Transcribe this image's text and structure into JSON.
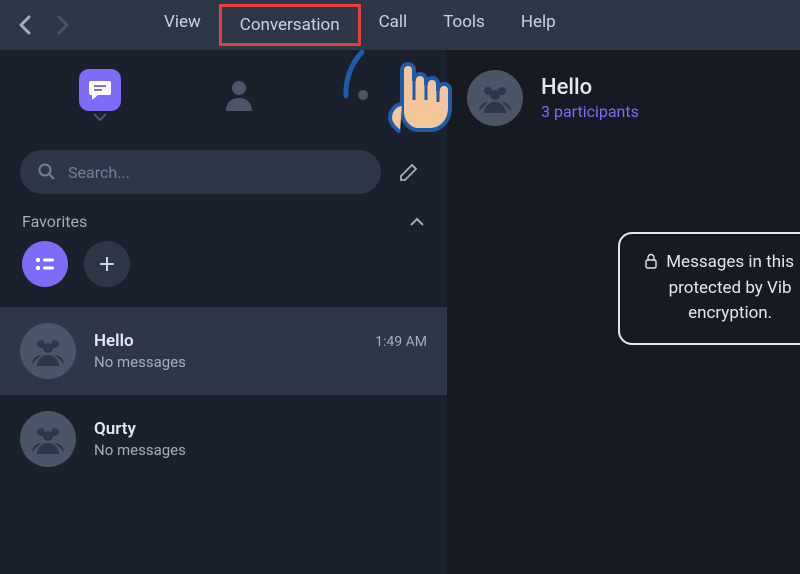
{
  "menu": {
    "items": [
      "View",
      "Conversation",
      "Call",
      "Tools",
      "Help"
    ],
    "highlighted_index": 1
  },
  "sidebar": {
    "search": {
      "placeholder": "Search..."
    },
    "favorites": {
      "label": "Favorites"
    },
    "chats": [
      {
        "name": "Hello",
        "subtitle": "No messages",
        "time": "1:49 AM",
        "selected": true,
        "avatar": "group"
      },
      {
        "name": "Qurty",
        "subtitle": "No messages",
        "time": "",
        "selected": false,
        "avatar": "group"
      }
    ]
  },
  "conversation": {
    "title": "Hello",
    "participants": "3 participants",
    "info_line1": "Messages in this",
    "info_line2": "protected by Vib",
    "info_line3": "encryption."
  }
}
